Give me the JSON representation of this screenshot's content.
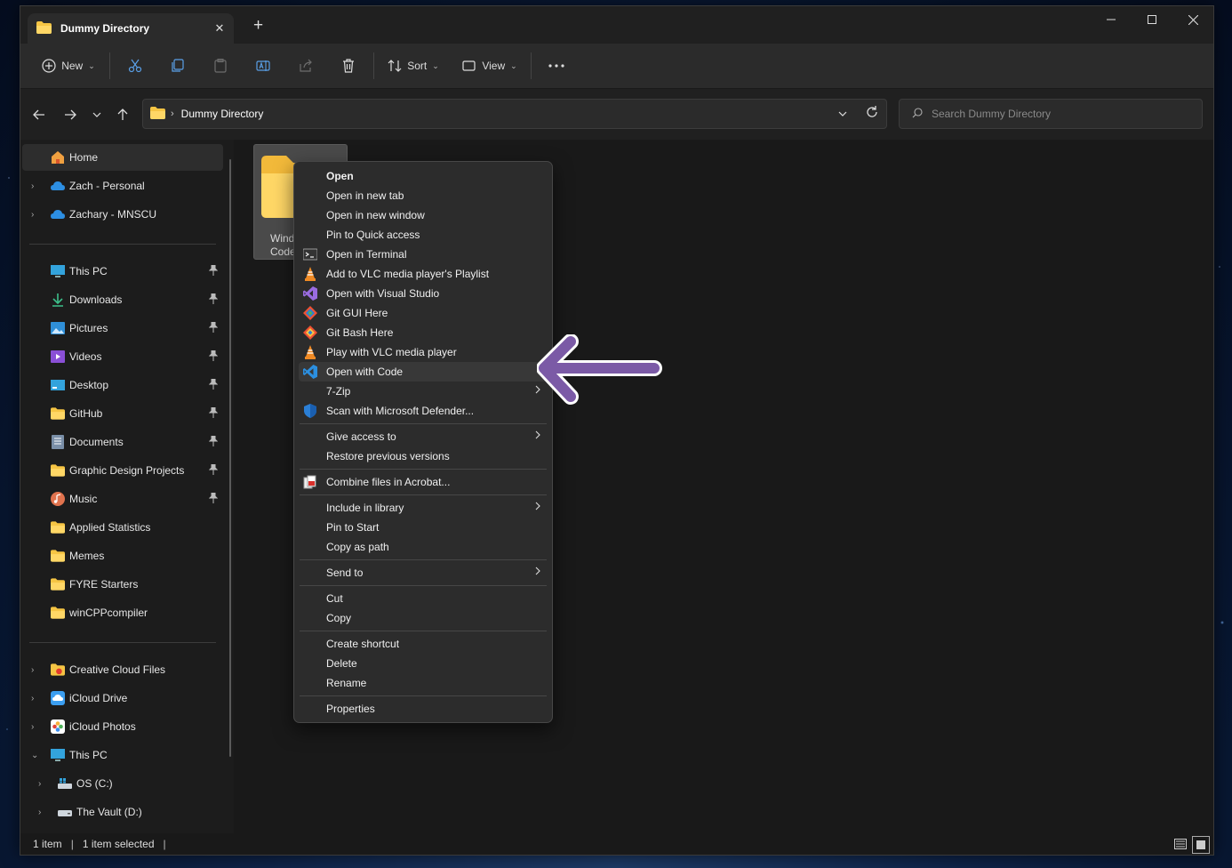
{
  "tab": {
    "title": "Dummy Directory",
    "close_symbol": "✕",
    "new_tab_symbol": "+"
  },
  "toolbar": {
    "new_label": "New",
    "sort_label": "Sort",
    "view_label": "View"
  },
  "address": {
    "path": "Dummy Directory",
    "separator": "›"
  },
  "search": {
    "placeholder": "Search Dummy Directory"
  },
  "nav": {
    "home": "Home",
    "cloud1": "Zach - Personal",
    "cloud2": "Zachary - MNSCU",
    "quick": [
      "This PC",
      "Downloads",
      "Pictures",
      "Videos",
      "Desktop",
      "GitHub",
      "Documents",
      "Graphic Design Projects",
      "Music",
      "Applied Statistics",
      "Memes",
      "FYRE Starters",
      "winCPPcompiler"
    ],
    "lower": [
      "Creative Cloud Files",
      "iCloud Drive",
      "iCloud Photos",
      "This PC"
    ],
    "drives": [
      "OS (C:)",
      "The Vault (D:)"
    ]
  },
  "folder": {
    "line1": "Wind",
    "line2": "Code"
  },
  "context_menu": [
    "Open",
    "Open in new tab",
    "Open in new window",
    "Pin to Quick access",
    "Open in Terminal",
    "Add to VLC media player's Playlist",
    "Open with Visual Studio",
    "Git GUI Here",
    "Git Bash Here",
    "Play with VLC media player",
    "Open with Code",
    "7-Zip",
    "Scan with Microsoft Defender...",
    "Give access to",
    "Restore previous versions",
    "Combine files in Acrobat...",
    "Include in library",
    "Pin to Start",
    "Copy as path",
    "Send to",
    "Cut",
    "Copy",
    "Create shortcut",
    "Delete",
    "Rename",
    "Properties"
  ],
  "status": {
    "items": "1 item",
    "selected": "1 item selected",
    "cursor": "|"
  },
  "colors": {
    "accent_arrow": "#7b5aa6",
    "folder_yellow": "#f6c544",
    "vscode_blue": "#2b8fe0",
    "vlc_orange": "#f08a24"
  }
}
